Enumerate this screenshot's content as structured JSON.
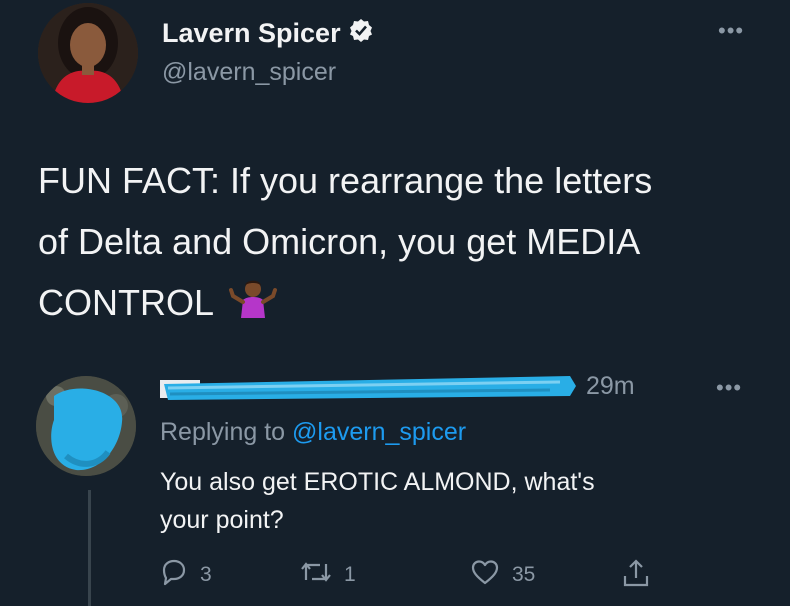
{
  "tweet": {
    "author_name": "Lavern Spicer",
    "author_handle": "@lavern_spicer",
    "text_parts": [
      "FUN FACT: If you rearrange the letters",
      "of Delta and Omicron, you get MEDIA",
      "CONTROL"
    ],
    "emoji": "person-shrugging-emoji",
    "more_icon": "more-horizontal-icon",
    "verified_icon": "verified-badge-icon"
  },
  "reply": {
    "time": "29m",
    "replying_prefix": "Replying to",
    "replying_to": "@lavern_spicer",
    "text_line1": "You also get EROTIC ALMOND, what's",
    "text_line2": "your point?",
    "counts": {
      "replies": "3",
      "retweets": "1",
      "likes": "35"
    },
    "icons": [
      "reply-icon",
      "retweet-icon",
      "like-icon",
      "share-icon"
    ]
  },
  "colors": {
    "background": "#15202b",
    "text": "#e7e9ea",
    "secondary": "#8b98a5",
    "accent": "#1d9bf0",
    "redaction": "#29aee6"
  }
}
